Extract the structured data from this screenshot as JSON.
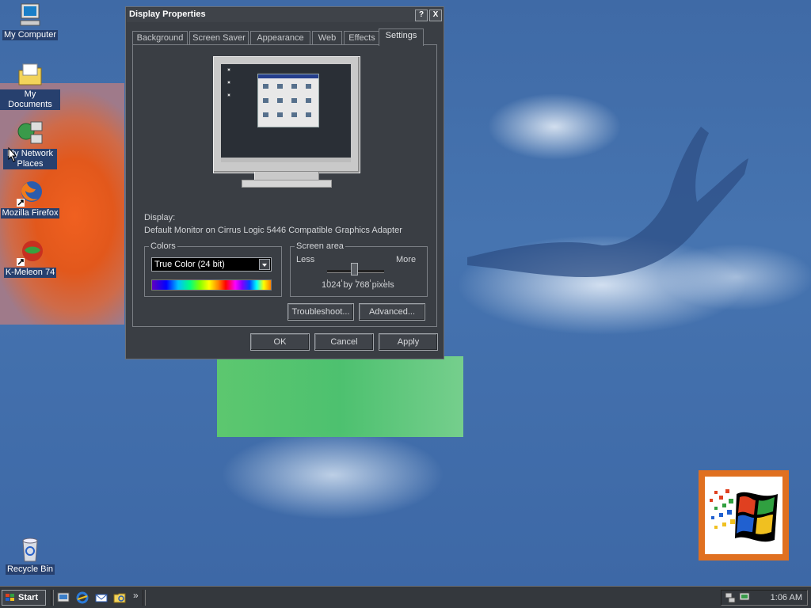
{
  "desktop": {
    "icons": [
      {
        "label": "My Computer",
        "icon": "my-computer-icon"
      },
      {
        "label": "My Documents",
        "icon": "my-documents-icon"
      },
      {
        "label": "My Network Places",
        "icon": "network-places-icon"
      },
      {
        "label": "Mozilla Firefox",
        "icon": "firefox-icon"
      },
      {
        "label": "K-Meleon 74",
        "icon": "k-meleon-icon"
      },
      {
        "label": "Recycle Bin",
        "icon": "recycle-bin-icon"
      }
    ]
  },
  "dialog": {
    "title": "Display Properties",
    "help_btn": "?",
    "close_btn": "X",
    "tabs": [
      "Background",
      "Screen Saver",
      "Appearance",
      "Web",
      "Effects",
      "Settings"
    ],
    "active_tab": "Settings",
    "display_label": "Display:",
    "display_value": "Default Monitor on Cirrus Logic 5446 Compatible Graphics Adapter",
    "colors": {
      "legend": "Colors",
      "selected": "True Color (24 bit)"
    },
    "screen_area": {
      "legend": "Screen area",
      "less": "Less",
      "more": "More",
      "resolution": "1024 by 768 pixels",
      "slider_position": 0.5
    },
    "troubleshoot_btn": "Troubleshoot...",
    "advanced_btn": "Advanced...",
    "ok_btn": "OK",
    "cancel_btn": "Cancel",
    "apply_btn": "Apply"
  },
  "taskbar": {
    "start_label": "Start",
    "quicklaunch": [
      "show-desktop-icon",
      "internet-explorer-icon",
      "outlook-express-icon",
      "windows-explorer-icon"
    ],
    "chevron": "»",
    "clock": "1:06 AM"
  },
  "colors": {
    "dialog_bg": "#3a3e44",
    "desktop_blue": "#4674b0",
    "logo_orange": "#e07020"
  }
}
